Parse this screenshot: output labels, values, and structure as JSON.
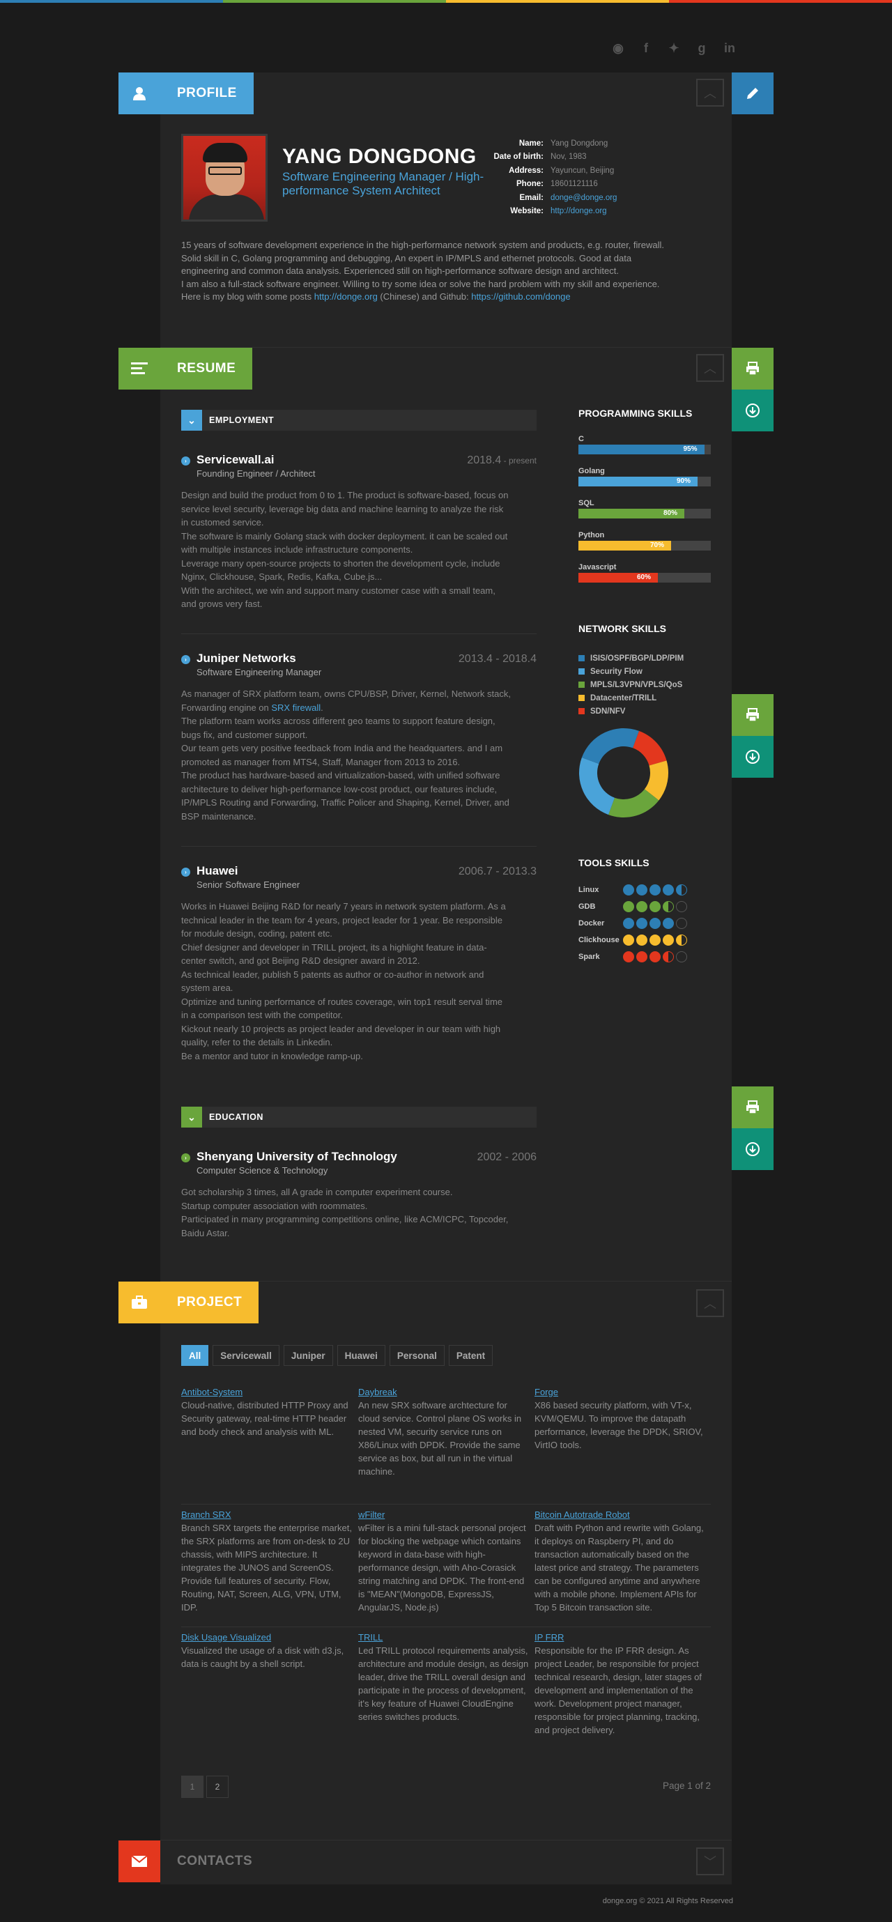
{
  "colors": {
    "blue": "#4aa3d9",
    "green": "#6aa53c",
    "yellow": "#f7bc2e",
    "red": "#e3371e",
    "teal": "#0f9178",
    "darkblue": "#2d7fb5"
  },
  "social": [
    "rss-icon",
    "facebook-icon",
    "twitter-icon",
    "googleplus-icon",
    "linkedin-icon"
  ],
  "profile": {
    "section_label": "PROFILE",
    "name": "YANG DONGDONG",
    "title": "Software Engineering Manager / High-performance System Architect",
    "info": [
      {
        "k": "Name:",
        "v": "Yang Dongdong"
      },
      {
        "k": "Date of birth:",
        "v": "Nov, 1983"
      },
      {
        "k": "Address:",
        "v": "Yayuncun, Beijing"
      },
      {
        "k": "Phone:",
        "v": "18601121116"
      },
      {
        "k": "Email:",
        "v": "donge@donge.org"
      },
      {
        "k": "Website:",
        "v": "http://donge.org"
      }
    ],
    "bio_lines": [
      "15 years of software development experience in the high-performance network system and products, e.g. router, firewall.",
      "Solid skill in C, Golang programming and debugging, An expert in IP/MPLS and ethernet protocols. Good at data",
      "engineering and common data analysis. Experienced still on high-performance software design and architect.",
      "I am also a full-stack software engineer. Willing to try some idea or solve the hard problem with my skill and experience."
    ],
    "bio_last_prefix": "Here is my blog with some posts ",
    "bio_blog_link": "http://donge.org",
    "bio_mid": " (Chinese) and Github: ",
    "bio_github_link": "https://github.com/donge"
  },
  "resume": {
    "section_label": "RESUME",
    "employment_label": "EMPLOYMENT",
    "education_label": "EDUCATION",
    "jobs": [
      {
        "company": "Servicewall.ai",
        "date": "2018.4",
        "date_suffix": " - present",
        "role": "Founding Engineer / Architect",
        "desc": [
          "Design and build the product from 0 to 1. The product is software-based, focus on",
          "service level security, leverage big data and machine learning to analyze the risk",
          "in customed service.",
          "The software is mainly Golang stack with docker deployment. it can be scaled out",
          "with multiple instances include infrastructure components.",
          "Leverage many open-source projects to shorten the development cycle, include",
          "Nginx, Clickhouse, Spark, Redis, Kafka, Cube.js...",
          "With the architect, we win and support many customer case with a small team,",
          "and grows very fast."
        ]
      },
      {
        "company": "Juniper Networks",
        "date": "2013.4 - 2018.4",
        "role": "Software Engineering Manager",
        "desc_first": "As manager of SRX platform team, owns CPU/BSP, Driver, Kernel, Network stack,",
        "desc_link_prefix": "Forwarding engine on ",
        "desc_link": "SRX firewall",
        "desc_link_suffix": ".",
        "desc": [
          "The platform team works across different geo teams to support feature design,",
          "bugs fix, and customer support.",
          "Our team gets very positive feedback from India and the headquarters. and I am",
          "promoted as manager from MTS4, Staff, Manager from 2013 to 2016.",
          "The product has hardware-based and virtualization-based, with unified software",
          "architecture to deliver high-performance low-cost product, our features include,",
          "IP/MPLS Routing and Forwarding, Traffic Policer and Shaping, Kernel, Driver, and",
          "BSP maintenance."
        ]
      },
      {
        "company": "Huawei",
        "date": "2006.7 - 2013.3",
        "role": "Senior Software Engineer",
        "desc": [
          "Works in Huawei Beijing R&D for nearly 7 years in network system platform. As a",
          "technical leader in the team for 4 years, project leader for 1 year. Be responsible",
          "for module design, coding, patent etc.",
          "Chief designer and developer in TRILL project, its a highlight feature in data-",
          "center switch, and got Beijing R&D designer award in 2012.",
          "As technical leader, publish 5 patents as author or co-author in network and",
          "system area.",
          "Optimize and tuning performance of routes coverage, win top1 result serval time",
          "in a comparison test with the competitor.",
          "Kickout nearly 10 projects as project leader and developer in our team with high",
          "quality, refer to the details in Linkedin.",
          "Be a mentor and tutor in knowledge ramp-up."
        ]
      }
    ],
    "education": {
      "school": "Shenyang University of Technology",
      "date": "2002 - 2006",
      "major": "Computer Science & Technology",
      "desc": [
        "Got scholarship 3 times, all A grade in computer experiment course.",
        "Startup computer association with roommates.",
        "Participated in many programming competitions online, like ACM/ICPC, Topcoder,",
        "Baidu Astar."
      ]
    },
    "programming_title": "PROGRAMMING SKILLS",
    "programming": [
      {
        "name": "C",
        "pct": 95,
        "label": "95%",
        "color": "#2d7fb5"
      },
      {
        "name": "Golang",
        "pct": 90,
        "label": "90%",
        "color": "#4aa3d9"
      },
      {
        "name": "SQL",
        "pct": 80,
        "label": "80%",
        "color": "#6aa53c"
      },
      {
        "name": "Python",
        "pct": 70,
        "label": "70%",
        "color": "#f7bc2e"
      },
      {
        "name": "Javascript",
        "pct": 60,
        "label": "60%",
        "color": "#e3371e"
      }
    ],
    "network_title": "NETWORK SKILLS",
    "network": [
      {
        "name": "ISIS/OSPF/BGP/LDP/PIM",
        "color": "#2d7fb5",
        "share": 25
      },
      {
        "name": "Security Flow",
        "color": "#4aa3d9",
        "share": 25
      },
      {
        "name": "MPLS/L3VPN/VPLS/QoS",
        "color": "#6aa53c",
        "share": 20
      },
      {
        "name": "Datacenter/TRILL",
        "color": "#f7bc2e",
        "share": 15
      },
      {
        "name": "SDN/NFV",
        "color": "#e3371e",
        "share": 15
      }
    ],
    "tools_title": "TOOLS SKILLS",
    "tools": [
      {
        "name": "Linux",
        "level": 4.5,
        "color": "#2d7fb5"
      },
      {
        "name": "GDB",
        "level": 3.5,
        "color": "#6aa53c"
      },
      {
        "name": "Docker",
        "level": 4,
        "color": "#2d7fb5"
      },
      {
        "name": "Clickhouse",
        "level": 4.5,
        "color": "#f7bc2e"
      },
      {
        "name": "Spark",
        "level": 3.5,
        "color": "#e3371e"
      }
    ]
  },
  "project": {
    "section_label": "PROJECT",
    "filters": [
      "All",
      "Servicewall",
      "Juniper",
      "Huawei",
      "Personal",
      "Patent"
    ],
    "items": [
      {
        "title": "Antibot-System",
        "desc": "Cloud-native, distributed HTTP Proxy and Security gateway, real-time HTTP header and body check and analysis with ML."
      },
      {
        "title": "Daybreak",
        "desc": "An new SRX software archtecture for cloud service. Control plane OS works in nested VM, security service runs on X86/Linux with DPDK. Provide the same service as box, but all run in the virtual machine."
      },
      {
        "title": "Forge",
        "desc": "X86 based security platform, with VT-x, KVM/QEMU. To improve the datapath performance, leverage the DPDK, SRIOV, VirtIO tools."
      },
      {
        "title": "Branch SRX",
        "desc": "Branch SRX targets the enterprise market, the SRX platforms are from on-desk to 2U chassis, with MIPS architecture. It integrates the JUNOS and ScreenOS. Provide full features of security. Flow, Routing, NAT, Screen, ALG, VPN, UTM, IDP."
      },
      {
        "title": "wFilter",
        "desc": "wFilter is a mini full-stack personal project for blocking the webpage which contains keyword in data-base with high-performance design, with Aho-Corasick string matching and DPDK. The front-end is \"MEAN\"(MongoDB, ExpressJS, AngularJS, Node.js)"
      },
      {
        "title": "Bitcoin Autotrade Robot",
        "desc": "Draft with Python and rewrite with Golang, it deploys on Raspberry PI, and do transaction automatically based on the latest price and strategy. The parameters can be configured anytime and anywhere with a mobile phone. Implement APIs for Top 5 Bitcoin transaction site."
      },
      {
        "title": "Disk Usage Visualized",
        "desc": "Visualized the usage of a disk with d3.js, data is caught by a shell script."
      },
      {
        "title": "TRILL",
        "desc": "Led TRILL protocol requirements analysis, architecture and module design, as design leader, drive the TRILL overall design and participate in the process of development, it's key feature of Huawei CloudEngine series switches products."
      },
      {
        "title": "IP FRR",
        "desc": "Responsible for the IP FRR design. As project Leader, be responsible for project technical research, design, later stages of development and implementation of the work. Development project manager, responsible for project planning, tracking, and project delivery."
      }
    ],
    "pages": [
      "1",
      "2"
    ],
    "page_info": "Page 1 of 2"
  },
  "contacts": {
    "section_label": "CONTACTS"
  },
  "footer": "donge.org © 2021 All Rights Reserved"
}
